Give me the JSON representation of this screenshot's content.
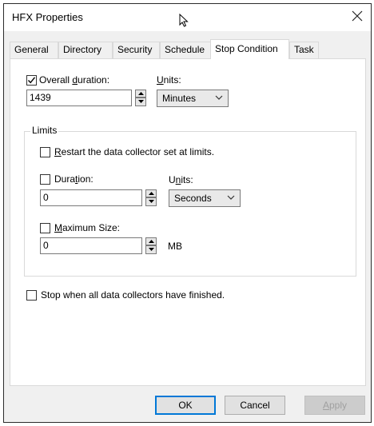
{
  "window": {
    "title": "HFX Properties"
  },
  "tabs": [
    {
      "label": "General"
    },
    {
      "label": "Directory"
    },
    {
      "label": "Security"
    },
    {
      "label": "Schedule"
    },
    {
      "label": "Stop Condition",
      "active": true
    },
    {
      "label": "Task"
    }
  ],
  "overall_duration": {
    "checked": true,
    "label_pre": "Overall ",
    "label_u": "d",
    "label_post": "uration:",
    "value": "1439",
    "units_label_u": "U",
    "units_label_post": "nits:",
    "units_value": "Minutes"
  },
  "limits": {
    "group_label": "Limits",
    "restart": {
      "checked": false,
      "label_u": "R",
      "label_post": "estart the data collector set at limits."
    },
    "duration": {
      "checked": false,
      "label_pre": "Dura",
      "label_u": "t",
      "label_post": "ion:",
      "value": "0",
      "units_label_pre": "U",
      "units_label_u": "n",
      "units_label_post": "its:",
      "units_value": "Seconds"
    },
    "max_size": {
      "checked": false,
      "label_u": "M",
      "label_post": "aximum Size:",
      "value": "0",
      "unit": "MB"
    }
  },
  "stop_when_finished": {
    "checked": false,
    "label": "Stop when all data collectors have finished."
  },
  "buttons": {
    "ok": "OK",
    "cancel": "Cancel",
    "apply_u": "A",
    "apply_post": "pply"
  }
}
